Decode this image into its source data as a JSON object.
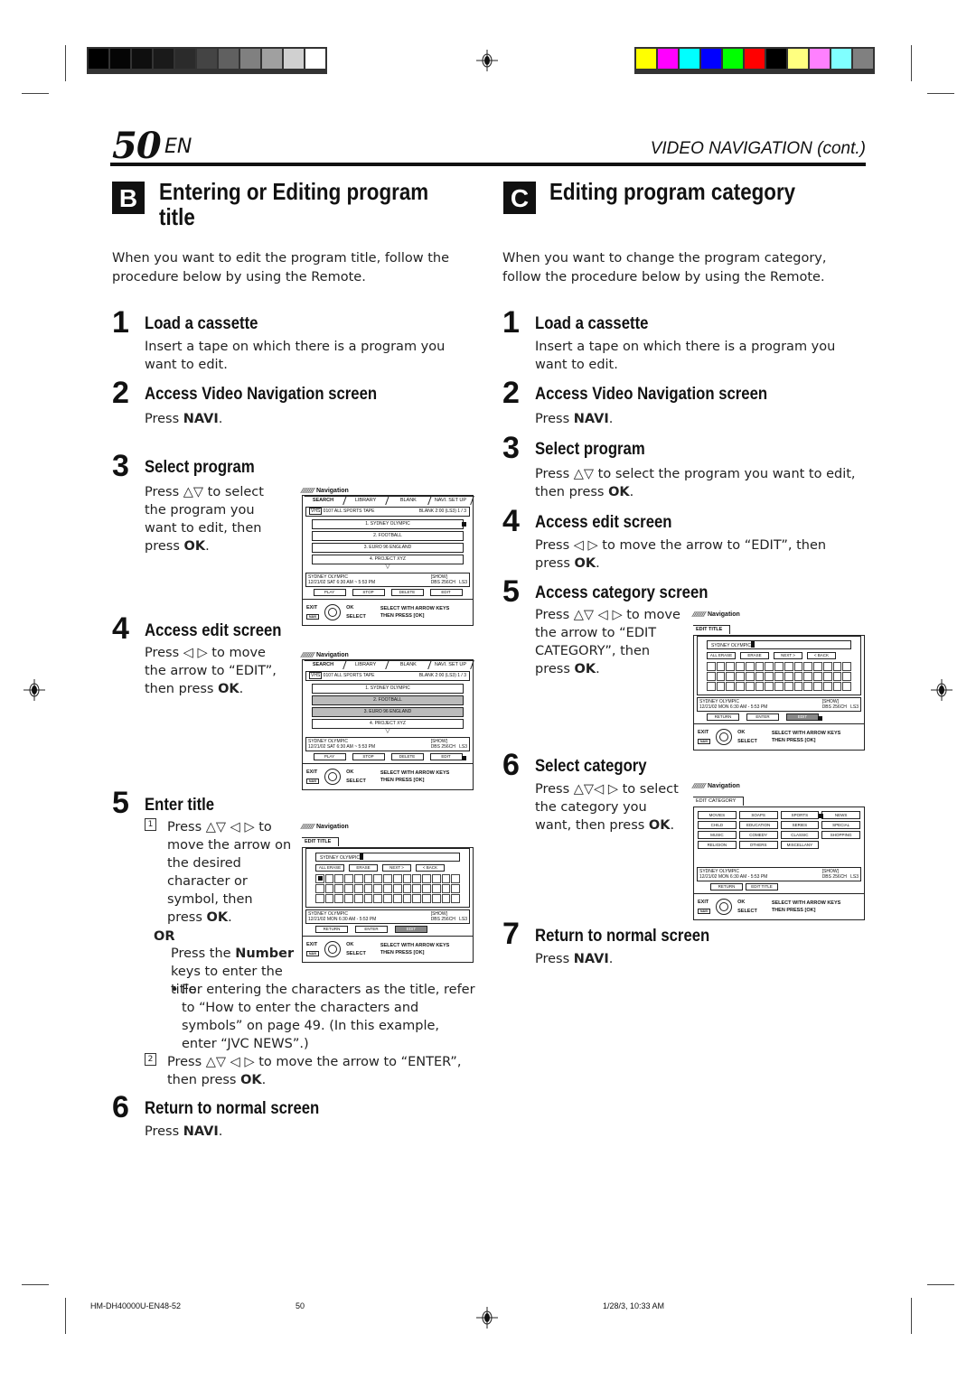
{
  "registration": {
    "grayscale_swatches": [
      "#000000",
      "#050505",
      "#0f0f0f",
      "#1a1a1a",
      "#2b2b2b",
      "#444444",
      "#606060",
      "#808080",
      "#a0a0a0",
      "#d0d0d0",
      "#ffffff"
    ],
    "color_swatches": [
      "#ffff00",
      "#ff00ff",
      "#00ffff",
      "#0000ff",
      "#00ff00",
      "#ff0000",
      "#000000",
      "#ffff80",
      "#ff80ff",
      "#80ffff",
      "#808080"
    ]
  },
  "header": {
    "page_number": "50",
    "language": "EN",
    "running_head": "VIDEO NAVIGATION (cont.)"
  },
  "section_b": {
    "badge": "B",
    "title_line1": "Entering or Editing program",
    "title_line2": "title",
    "intro": "When you want to edit the program title, follow the procedure below by using the Remote.",
    "steps": [
      {
        "num": "1",
        "title": "Load a cassette",
        "body": "Insert a tape on which there is a program you want to edit."
      },
      {
        "num": "2",
        "title": "Access Video Navigation screen",
        "body_pre": "Press ",
        "body_bold": "NAVI",
        "body_post": "."
      },
      {
        "num": "3",
        "title": "Select program",
        "body_pre": "Press △▽ to select the program you want to edit, then press ",
        "body_bold": "OK",
        "body_post": "."
      },
      {
        "num": "4",
        "title": "Access edit screen",
        "body_pre": "Press ◁ ▷ to move the arrow to “EDIT”, then press ",
        "body_bold": "OK",
        "body_post": "."
      },
      {
        "num": "5",
        "title": "Enter title",
        "sub1_num": "1",
        "sub1_pre": "Press △▽ ◁ ▷ to move the arrow on the desired character or symbol, then press ",
        "sub1_bold": "OK",
        "sub1_post": ".",
        "or": "OR",
        "alt_pre": "Press the ",
        "alt_bold": "Number",
        "alt_post": " keys to enter the title.",
        "bullet": "For entering the characters as the title, refer to “How to enter the characters and symbols” on page 49. (In this example, enter “JVC NEWS”.)",
        "sub2_num": "2",
        "sub2_pre": "Press △▽ ◁ ▷ to move the arrow to “ENTER”, then press ",
        "sub2_bold": "OK",
        "sub2_post": "."
      },
      {
        "num": "6",
        "title": "Return to normal screen",
        "body_pre": "Press ",
        "body_bold": "NAVI",
        "body_post": "."
      }
    ]
  },
  "section_c": {
    "badge": "C",
    "title": "Editing program category",
    "intro": "When you want to change the program category, follow the procedure below by using the Remote.",
    "steps": [
      {
        "num": "1",
        "title": "Load a cassette",
        "body": "Insert a tape on which there is a program you want to edit."
      },
      {
        "num": "2",
        "title": "Access Video Navigation screen",
        "body_pre": "Press ",
        "body_bold": "NAVI",
        "body_post": "."
      },
      {
        "num": "3",
        "title": "Select program",
        "body_pre": "Press △▽ to select the program you want to edit, then press ",
        "body_bold": "OK",
        "body_post": "."
      },
      {
        "num": "4",
        "title": "Access edit screen",
        "body_pre": "Press ◁ ▷ to move the arrow to “EDIT”, then press ",
        "body_bold": "OK",
        "body_post": "."
      },
      {
        "num": "5",
        "title": "Access category screen",
        "body_pre": "Press △▽  ◁ ▷ to move the arrow to “EDIT CATEGORY”, then press ",
        "body_bold": "OK",
        "body_post": "."
      },
      {
        "num": "6",
        "title": "Select category",
        "body_pre": "Press △▽◁ ▷ to select the category you want, then press ",
        "body_bold": "OK",
        "body_post": "."
      },
      {
        "num": "7",
        "title": "Return to normal screen",
        "body_pre": "Press ",
        "body_bold": "NAVI",
        "body_post": "."
      }
    ]
  },
  "osd": {
    "label": "Navigation",
    "tabs": [
      "SEARCH",
      "LIBRARY",
      "BLANK",
      "NAVI. SET UP"
    ],
    "tape_icon": "VHS",
    "tape_name": "0107 ALL SPORTS TAPE",
    "tape_status": "BLANK 2:00 (LS3)   1 / 3",
    "programs": [
      "1. SYDNEY OLYMPIC",
      "2. FOOTBALL",
      "3. EURO 96 ENGLAND",
      "4. PROJECT XYZ"
    ],
    "info_title": "SYDNEY OLYMPIC",
    "info_time_sat": "12/21/02 SAT  6:30 AM ~ 5:53 PM",
    "info_time_mon": "12/21/02 MON   6:30 AM - 5:53 PM",
    "info_cat": "[SHOW]",
    "info_ch": "DBS 256CH",
    "info_speed": "LS3",
    "search_buttons": [
      "PLAY",
      "STOP",
      "DELETE",
      "EDIT"
    ],
    "foot_exit": "EXIT",
    "foot_navi": "NAVI",
    "foot_ok": "OK",
    "foot_select": "SELECT",
    "foot_msg1": "SELECT WITH ARROW KEYS",
    "foot_msg2": "THEN PRESS [OK]",
    "edit_title_tab": "EDIT TITLE",
    "edit_title_value": "SYDNEY OLYMPIC",
    "edit_actions": [
      "ALL ERASE",
      "ERASE",
      "NEXT >",
      "< BACK"
    ],
    "edit_buttons": [
      "RETURN",
      "ENTER",
      "EDIT CATEGORY"
    ],
    "edit_category_tab": "EDIT CATEGORY",
    "categories": [
      "MOVIES",
      "SOAPS",
      "SPORTS",
      "NEWS",
      "CHILD",
      "EDUCATION",
      "SERIES",
      "SPECIAL",
      "MUSIC",
      "COMEDY",
      "CLASSIC",
      "SHOPPING",
      "RELIGION",
      "OTHERS",
      "MISCELLANY"
    ],
    "category_buttons": [
      "RETURN",
      "EDIT TITLE"
    ]
  },
  "footer": {
    "doc_code": "HM-DH40000U-EN48-52",
    "page": "50",
    "timestamp": "1/28/3, 10:33 AM"
  }
}
